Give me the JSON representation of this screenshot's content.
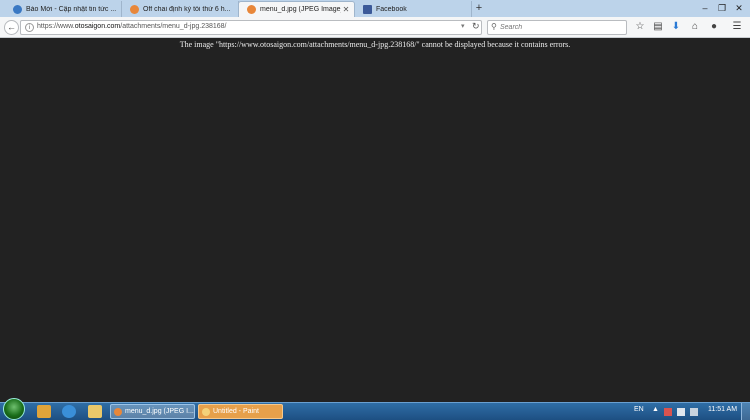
{
  "browser": {
    "tabs": [
      {
        "title": "Báo Mới - Cập nhật tin tức ...",
        "favicon_color": "#3a78c3",
        "active": false
      },
      {
        "title": "Off chai định kỳ tối thứ 6 h...",
        "favicon_color": "#e8873a",
        "active": false
      },
      {
        "title": "menu_d.jpg (JPEG Image)",
        "favicon_color": "#e8873a",
        "active": true
      },
      {
        "title": "Facebook",
        "favicon_color": "#3b5998",
        "active": false
      }
    ],
    "new_tab": "+",
    "url_prefix": "https://www.",
    "url_host": "otosaigon.com",
    "url_path": "/attachments/menu_d-jpg.238168/",
    "search_placeholder": "Search"
  },
  "content": {
    "error_message": "The image \"https://www.otosaigon.com/attachments/menu_d-jpg.238168/\" cannot be displayed because it contains errors."
  },
  "taskbar": {
    "tasks": [
      {
        "label": "menu_d.jpg (JPEG I...",
        "icon_color": "#e8873a"
      },
      {
        "label": "Untitled - Paint",
        "icon_color": "#f3d27a"
      }
    ],
    "language": "EN",
    "clock": "11:51 AM"
  },
  "colors": {
    "tabstrip": "#bcd3ea",
    "content_bg": "#222222",
    "taskbar": "#245d93"
  }
}
